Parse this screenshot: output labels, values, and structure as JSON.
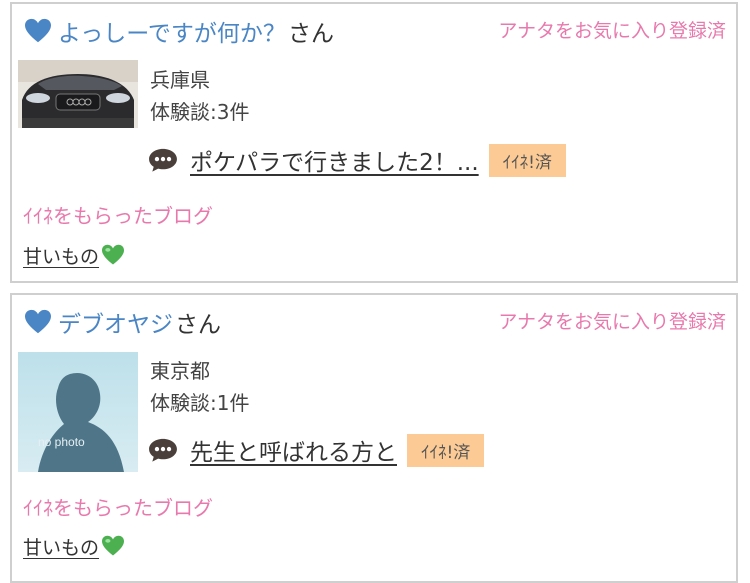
{
  "users": [
    {
      "name": "よっしーですが何か？",
      "honorific": "さん",
      "favorite_status": "アナタをお気に入り登録済",
      "prefecture": "兵庫県",
      "experience": "体験談:3件",
      "blog_title": "ポケパラで行きました2！...",
      "like_badge": "ｲｲﾈ!済",
      "likes_label": "ｲｲﾈをもらったブログ",
      "liked_blog": "甘いもの"
    },
    {
      "name": "デブオヤジ",
      "honorific": "さん",
      "favorite_status": "アナタをお気に入り登録済",
      "prefecture": "東京都",
      "experience": "体験談:1件",
      "blog_title": "先生と呼ばれる方と",
      "like_badge": "ｲｲﾈ!済",
      "likes_label": "ｲｲﾈをもらったブログ",
      "liked_blog": "甘いもの",
      "avatar_text": "no photo"
    }
  ],
  "colors": {
    "username": "#4a86c5",
    "pink": "#e879ad",
    "badge_bg": "#fccb95",
    "green_heart": "#4caf50"
  }
}
